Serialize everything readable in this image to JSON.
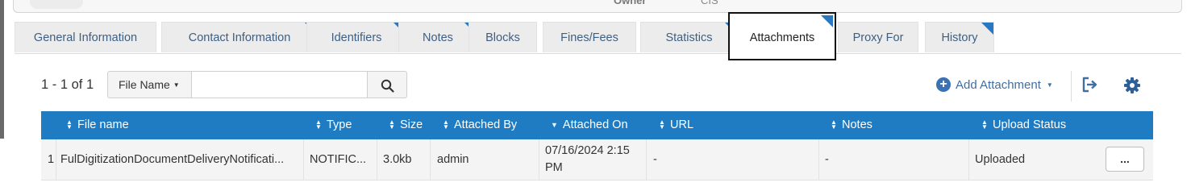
{
  "header_fragment": {
    "label": "Owner",
    "value": "CIS"
  },
  "tabs": [
    {
      "label": "General Information",
      "flag": false
    },
    {
      "label": "Contact Information",
      "flag": true
    },
    {
      "label": "Identifiers",
      "flag": true
    },
    {
      "label": "Notes",
      "flag": true
    },
    {
      "label": "Blocks",
      "flag": false
    },
    {
      "label": "Fines/Fees",
      "flag": false
    },
    {
      "label": "Statistics",
      "flag": true
    },
    {
      "label": "Attachments",
      "flag": true,
      "active": true
    },
    {
      "label": "Proxy For",
      "flag": false
    },
    {
      "label": "History",
      "flag": true
    }
  ],
  "toolbar": {
    "count": "1 - 1 of 1",
    "search_field": "File Name",
    "search_value": "",
    "search_icon": "search-icon",
    "add_label": "Add Attachment",
    "export_icon": "export-icon",
    "settings_icon": "gear-icon"
  },
  "table": {
    "columns": [
      {
        "label": "File name",
        "sort": "both"
      },
      {
        "label": "Type",
        "sort": "both"
      },
      {
        "label": "Size",
        "sort": "both"
      },
      {
        "label": "Attached By",
        "sort": "both"
      },
      {
        "label": "Attached On",
        "sort": "desc"
      },
      {
        "label": "URL",
        "sort": "both"
      },
      {
        "label": "Notes",
        "sort": "both"
      },
      {
        "label": "Upload Status",
        "sort": "both"
      }
    ],
    "rows": [
      {
        "index": "1",
        "file_name": "FulDigitizationDocumentDeliveryNotificati...",
        "type": "NOTIFIC...",
        "size": "3.0kb",
        "attached_by": "admin",
        "attached_on": "07/16/2024 2:15 PM",
        "url": "-",
        "notes": "-",
        "upload_status": "Uploaded",
        "actions_label": "..."
      }
    ]
  },
  "colors": {
    "header_blue": "#1f7cc2",
    "link_blue": "#3f6fa3",
    "tab_flag": "#2a78bf"
  }
}
